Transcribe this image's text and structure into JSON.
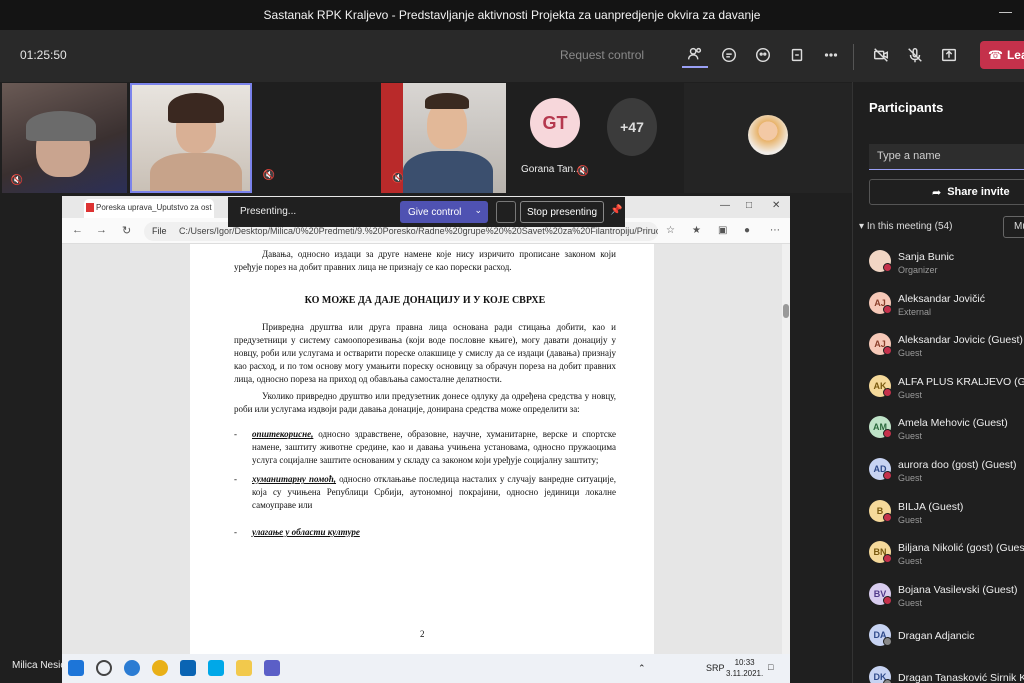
{
  "meeting": {
    "title": "Sastanak RPK Kraljevo - Predstavljanje aktivnosti Projekta za uanpredjenje okvira za davanje",
    "timer": "01:25:50",
    "request_control": "Request control",
    "leave_label": "Leave"
  },
  "toolbar_icons": [
    "people-icon",
    "chat-icon",
    "raise-hand-icon",
    "rooms-icon",
    "more-icon",
    "camera-off-icon",
    "mic-off-icon",
    "share-tray-icon"
  ],
  "videos": {
    "gorana_initials": "GT",
    "gorana_name": "Gorana Tan...",
    "more_count": "+47"
  },
  "presenting_bar": {
    "status": "Presenting...",
    "give_control": "Give control",
    "stop_presenting": "Stop presenting"
  },
  "browser": {
    "tab_title": "Poreska uprava_Uputstvo za ost",
    "file_label": "File",
    "url": "C:/Users/Igor/Desktop/Milica/0%20Predmeti/9.%20Poresko/Radne%20grupe%20%20Savet%20za%20Filantropiju/Prirucnik/Onlin..."
  },
  "document": {
    "p1": "Давања, односно издаци за друге намене које нису изричито прописане законом који уређује порез на добит правних лица не признају се као порески расход.",
    "heading": "КО МОЖЕ ДА ДАЈЕ ДОНАЦИЈУ И У КОЈЕ СВРХЕ",
    "p2": "Привредна друштва или друга правна лица основана ради стицања добити, као и предузетници у систему самоопорезивања (који воде пословне књиге), могу давати донацију у новцу, роби или услугама и остварити пореске олакшице у смислу да се издаци (давања) признају као расход, и по том основу могу умањити пореску основицу за обрачун пореза на добит правних лица, односно пореза на приход од обављања самосталне делатности.",
    "p3": "Уколико привредно друштво или предузетник донесе одлуку да одређена средства у новцу, роби или услугама издвоји ради давања донације, донирана средства може определити за:",
    "b1_em": "општекорисне,",
    "b1": " односно здравствене, образовне, научне, хуманитарне, верске и спортске намене, заштиту животне средине, као и давања учињена установама, односно пружаоцима услуга социјалне заштите основаним у складу са законом који уређује социјалну заштиту;",
    "b2_em": "хуманитарну помоћ,",
    "b2": " односно отклањање последица насталих у случају ванредне ситуације, која су учињена Републици Србији, аутономној покрајини, односно јединици локалне самоуправе или",
    "b3_em": "улагање у области културе",
    "dash": "-",
    "page_number": "2"
  },
  "taskbar": {
    "caption": "Milica Nesic",
    "lang": "SRP",
    "time": "10:33",
    "date": "3.11.2021."
  },
  "participants": {
    "title": "Participants",
    "search_placeholder": "Type a name",
    "share_invite": "Share invite",
    "in_meeting": "In this meeting (54)",
    "mute_all": "Mu",
    "list": [
      {
        "initials": "",
        "name": "Sanja Bunic",
        "role": "Organizer",
        "bg": "#f1d6c4",
        "fg": "#7a4b2a",
        "dot": "#c4314b"
      },
      {
        "initials": "AJ",
        "name": "Aleksandar Jovičić",
        "role": "External",
        "bg": "#f6c9b8",
        "fg": "#8a3f2b",
        "dot": "#c4314b"
      },
      {
        "initials": "AJ",
        "name": "Aleksandar Jovicic (Guest)",
        "role": "Guest",
        "bg": "#f6c9b8",
        "fg": "#8a3f2b",
        "dot": "#c4314b"
      },
      {
        "initials": "AK",
        "name": "ALFA PLUS KRALJEVO (Guest)",
        "role": "Guest",
        "bg": "#f5d99a",
        "fg": "#7a5a10",
        "dot": "#c4314b"
      },
      {
        "initials": "AM",
        "name": "Amela Mehovic (Guest)",
        "role": "Guest",
        "bg": "#bfe3c8",
        "fg": "#2b6a3d",
        "dot": "#c4314b"
      },
      {
        "initials": "AD",
        "name": "aurora doo (gost) (Guest)",
        "role": "Guest",
        "bg": "#c7d3f2",
        "fg": "#2f4a8a",
        "dot": "#c4314b"
      },
      {
        "initials": "B",
        "name": "BILJA (Guest)",
        "role": "Guest",
        "bg": "#f5d99a",
        "fg": "#7a5a10",
        "dot": "#c4314b"
      },
      {
        "initials": "BN",
        "name": "Biljana Nikolić (gost) (Guest)",
        "role": "Guest",
        "bg": "#f5d99a",
        "fg": "#7a5a10",
        "dot": "#c4314b"
      },
      {
        "initials": "BV",
        "name": "Bojana Vasilevski (Guest)",
        "role": "Guest",
        "bg": "#d8cdef",
        "fg": "#503a8a",
        "dot": "#c4314b"
      },
      {
        "initials": "DA",
        "name": "Dragan Adjancic",
        "role": "",
        "bg": "#c7d3f2",
        "fg": "#2f4a8a",
        "dot": "#888"
      },
      {
        "initials": "DK",
        "name": "Dragan Tanasković Sirnik Kral",
        "role": "",
        "bg": "#c7d3f2",
        "fg": "#2f4a8a",
        "dot": "#888"
      }
    ]
  }
}
